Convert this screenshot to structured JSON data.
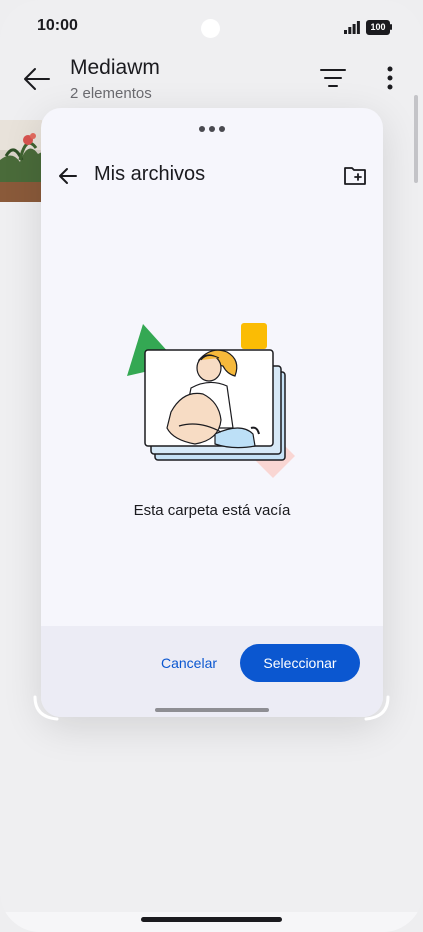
{
  "status": {
    "time": "10:00",
    "battery": "100"
  },
  "header": {
    "title": "Mediawm",
    "subtitle": "2 elementos"
  },
  "icons": {
    "back": "arrow-left-icon",
    "filter": "sort-lines-icon",
    "more": "more-vert-icon",
    "new_folder": "create-new-folder-icon",
    "drag_dots": "more-horiz-icon"
  },
  "picker": {
    "title": "Mis archivos",
    "empty_message": "Esta carpeta está vacía",
    "cancel_label": "Cancelar",
    "select_label": "Seleccionar"
  },
  "colors": {
    "accent": "#0b57d0",
    "sheet_bg": "#f6f6fc",
    "footer_bg": "#ececf5"
  }
}
